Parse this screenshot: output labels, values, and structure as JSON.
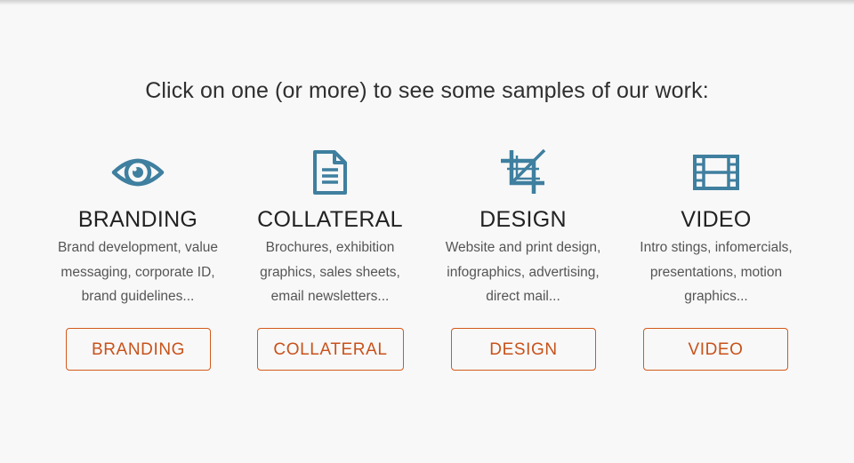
{
  "heading": "Click on one (or more) to see some samples of our work:",
  "accent_color": "#d35a1c",
  "icon_color": "#3f7f9f",
  "services": [
    {
      "icon": "eye-icon",
      "title": "BRANDING",
      "desc_lines": [
        "Brand development, value",
        "messaging, corporate ID,",
        "brand guidelines..."
      ],
      "button_label": "BRANDING"
    },
    {
      "icon": "document-icon",
      "title": "COLLATERAL",
      "desc_lines": [
        "Brochures, exhibition",
        "graphics, sales sheets,",
        "email newsletters..."
      ],
      "button_label": "COLLATERAL"
    },
    {
      "icon": "crop-icon",
      "title": "DESIGN",
      "desc_lines": [
        "Website and print design,",
        "infographics, advertising,",
        "direct mail..."
      ],
      "button_label": "DESIGN"
    },
    {
      "icon": "film-icon",
      "title": "VIDEO",
      "desc_lines": [
        "Intro stings, infomercials,",
        "presentations, motion",
        "graphics..."
      ],
      "button_label": "VIDEO"
    }
  ]
}
